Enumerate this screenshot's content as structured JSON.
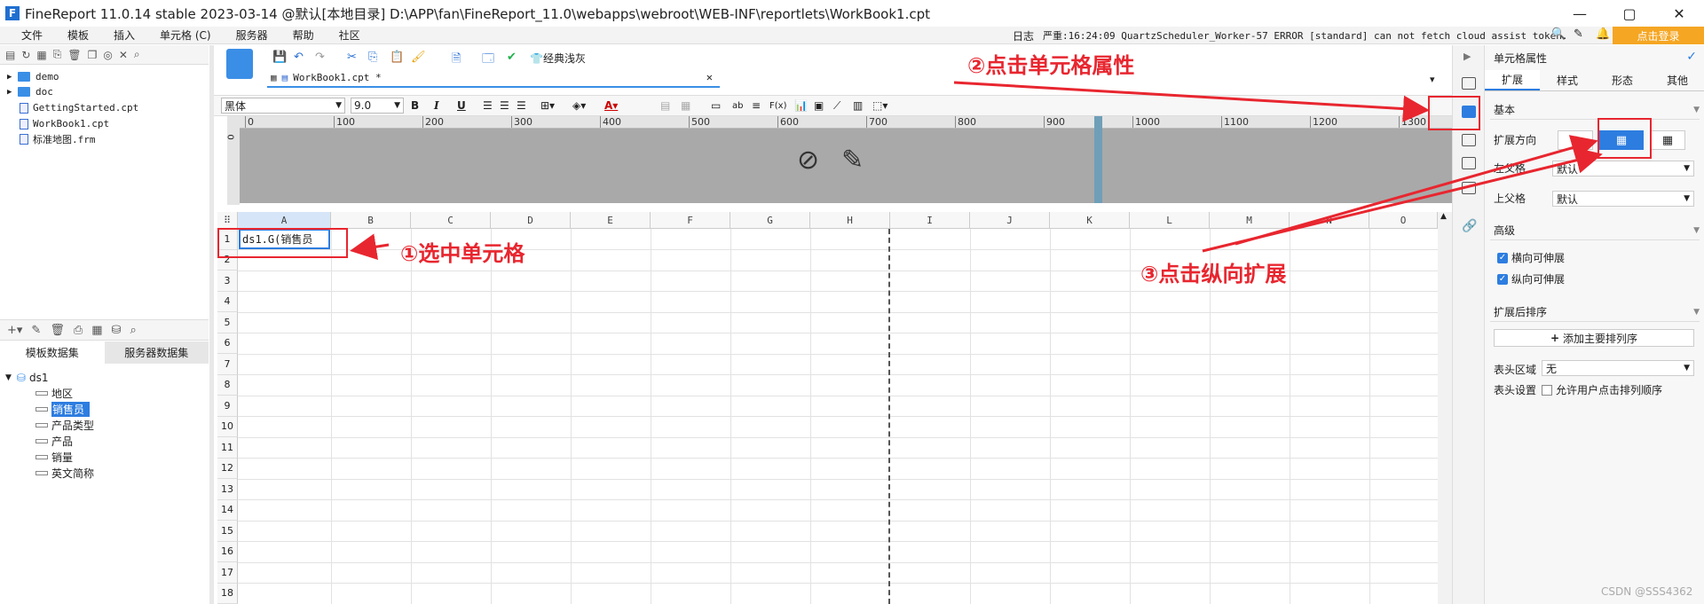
{
  "window": {
    "title": "FineReport 11.0.14 stable 2023-03-14 @默认[本地目录]    D:\\APP\\fan\\FineReport_11.0\\webapps\\webroot\\WEB-INF\\reportlets\\WorkBook1.cpt",
    "app_icon": "F",
    "min": "—",
    "max": "▢",
    "close": "✕"
  },
  "menu": [
    "文件",
    "模板",
    "插入",
    "单元格 (C)",
    "服务器",
    "帮助",
    "社区"
  ],
  "log": {
    "label": "日志",
    "text": "严重:16:24:09 QuartzScheduler_Worker-57 ERROR [standard] can not fetch cloud assist token.",
    "login": "点击登录"
  },
  "tree": {
    "items": [
      {
        "label": "demo",
        "type": "folder"
      },
      {
        "label": "doc",
        "type": "folder"
      },
      {
        "label": "GettingStarted.cpt",
        "type": "file"
      },
      {
        "label": "WorkBook1.cpt",
        "type": "file"
      },
      {
        "label": "标准地图.frm",
        "type": "file"
      }
    ]
  },
  "dataset": {
    "tabs": [
      "模板数据集",
      "服务器数据集"
    ],
    "root": "ds1",
    "fields": [
      "地区",
      "销售员",
      "产品类型",
      "产品",
      "销量",
      "英文简称"
    ],
    "selected_field": "销售员"
  },
  "toolbar": {
    "file_tab": "WorkBook1.cpt *",
    "theme": "经典浅灰"
  },
  "format": {
    "font": "黑体",
    "size": "9.0",
    "bold": "B",
    "italic": "I",
    "underline": "U"
  },
  "ruler": {
    "marks": [
      "0",
      "100",
      "200",
      "300",
      "400",
      "500",
      "600",
      "700",
      "800",
      "900",
      "1000",
      "1100",
      "1200",
      "1300"
    ]
  },
  "sheet": {
    "columns": [
      "A",
      "B",
      "C",
      "D",
      "E",
      "F",
      "G",
      "H",
      "I",
      "J",
      "K",
      "L",
      "M",
      "N",
      "O"
    ],
    "rows": [
      "1",
      "2",
      "3",
      "4",
      "5",
      "6",
      "7",
      "8",
      "9",
      "10",
      "11",
      "12",
      "13",
      "14",
      "15",
      "16",
      "17",
      "18"
    ],
    "cell_a1": "ds1.G(销售员"
  },
  "panel": {
    "title": "单元格属性",
    "tabs": [
      "扩展",
      "样式",
      "形态",
      "其他"
    ],
    "basic": "基本",
    "expand_dir": "扩展方向",
    "left_parent": "左父格",
    "top_parent": "上父格",
    "left_parent_val": "默认",
    "top_parent_val": "默认",
    "advanced": "高级",
    "h_expand": "横向可伸展",
    "v_expand": "纵向可伸展",
    "sort": "扩展后排序",
    "add_sort": "添加主要排列序",
    "header_area": "表头区域",
    "header_area_val": "无",
    "header_set": "表头设置",
    "allow_sort": "允许用户点击排列顺序"
  },
  "annotations": {
    "a1": "①选中单元格",
    "a2": "②点击单元格属性",
    "a3": "③点击纵向扩展"
  },
  "watermark": "CSDN @SSS4362",
  "colors": {
    "accent": "#2d7de0",
    "annotation": "#e8262f",
    "login": "#f5a623"
  }
}
